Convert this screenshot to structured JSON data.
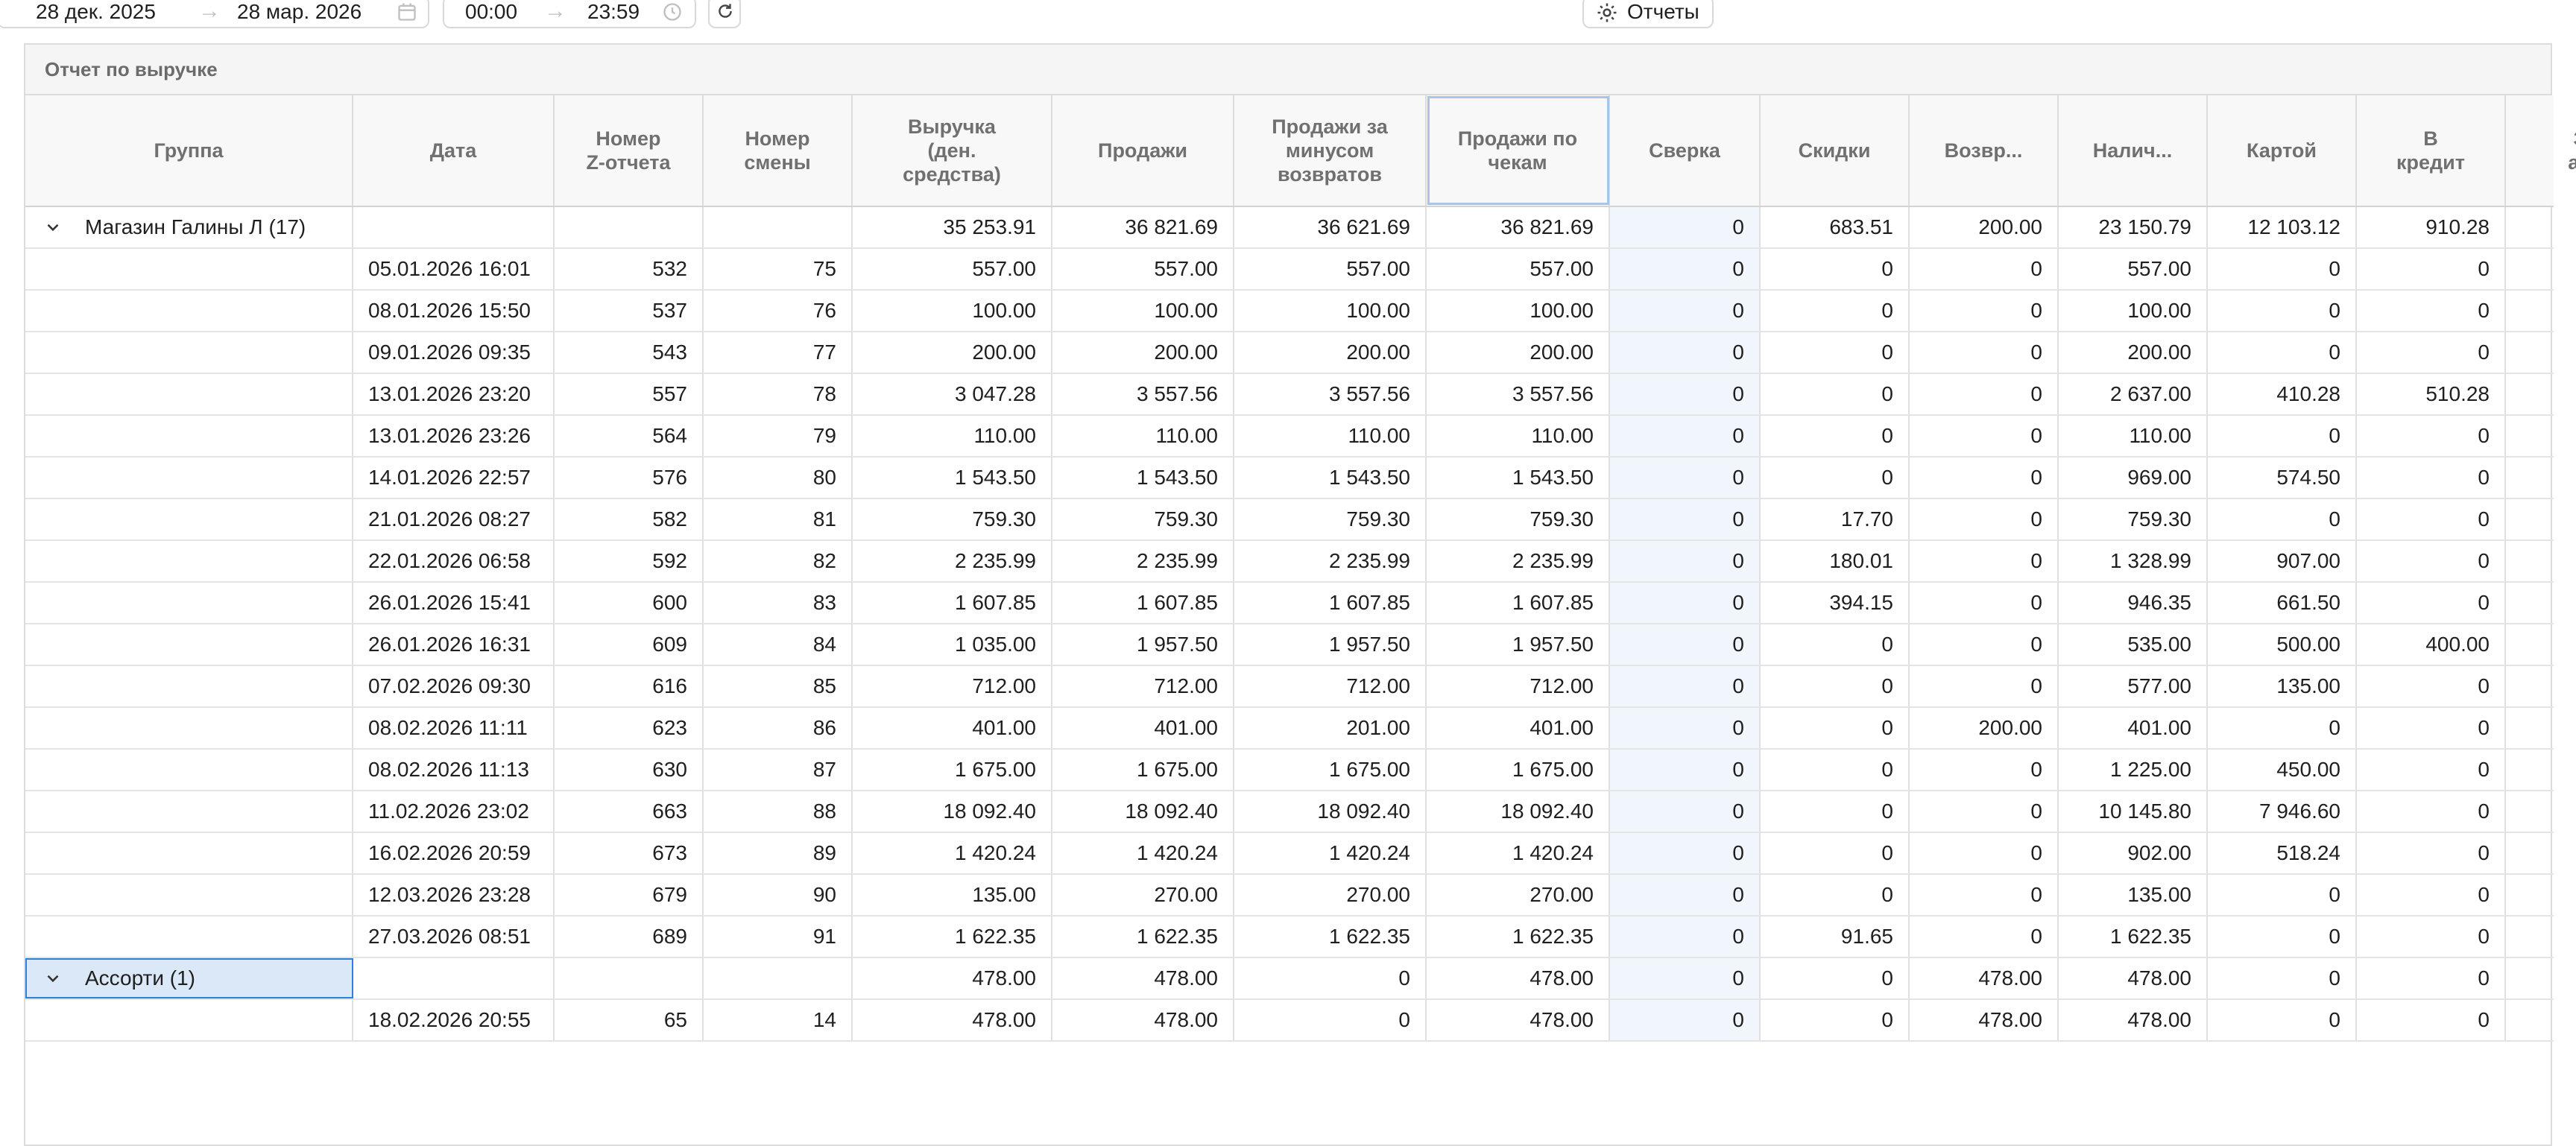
{
  "toolbar": {
    "date_from": "28 дек. 2025",
    "date_to": "28 мар. 2026",
    "time_from": "00:00",
    "time_to": "23:59",
    "arrow": "→",
    "reports_label": "Отчеты"
  },
  "report": {
    "title": "Отчет по выручке",
    "columns": [
      "Группа",
      "Дата",
      "Номер\nZ-отчета",
      "Номер\nсмены",
      "Выручка\n(ден.\nсредства)",
      "Продажи",
      "Продажи за\nминусом\nвозвратов",
      "Продажи по\nчекам",
      "Сверка",
      "Скидки",
      "Возвр...",
      "Налич...",
      "Картой",
      "В\nкредит",
      "З\nав"
    ],
    "groups": [
      {
        "name": "Магазин Галины Л (17)",
        "totals": [
          "",
          "",
          "",
          "35 253.91",
          "36 821.69",
          "36 621.69",
          "36 821.69",
          "0",
          "683.51",
          "200.00",
          "23 150.79",
          "12 103.12",
          "910.28",
          ""
        ],
        "rows": [
          [
            "05.01.2026 16:01",
            "532",
            "75",
            "557.00",
            "557.00",
            "557.00",
            "557.00",
            "0",
            "0",
            "0",
            "557.00",
            "0",
            "0",
            ""
          ],
          [
            "08.01.2026 15:50",
            "537",
            "76",
            "100.00",
            "100.00",
            "100.00",
            "100.00",
            "0",
            "0",
            "0",
            "100.00",
            "0",
            "0",
            ""
          ],
          [
            "09.01.2026 09:35",
            "543",
            "77",
            "200.00",
            "200.00",
            "200.00",
            "200.00",
            "0",
            "0",
            "0",
            "200.00",
            "0",
            "0",
            ""
          ],
          [
            "13.01.2026 23:20",
            "557",
            "78",
            "3 047.28",
            "3 557.56",
            "3 557.56",
            "3 557.56",
            "0",
            "0",
            "0",
            "2 637.00",
            "410.28",
            "510.28",
            ""
          ],
          [
            "13.01.2026 23:26",
            "564",
            "79",
            "110.00",
            "110.00",
            "110.00",
            "110.00",
            "0",
            "0",
            "0",
            "110.00",
            "0",
            "0",
            ""
          ],
          [
            "14.01.2026 22:57",
            "576",
            "80",
            "1 543.50",
            "1 543.50",
            "1 543.50",
            "1 543.50",
            "0",
            "0",
            "0",
            "969.00",
            "574.50",
            "0",
            ""
          ],
          [
            "21.01.2026 08:27",
            "582",
            "81",
            "759.30",
            "759.30",
            "759.30",
            "759.30",
            "0",
            "17.70",
            "0",
            "759.30",
            "0",
            "0",
            ""
          ],
          [
            "22.01.2026 06:58",
            "592",
            "82",
            "2 235.99",
            "2 235.99",
            "2 235.99",
            "2 235.99",
            "0",
            "180.01",
            "0",
            "1 328.99",
            "907.00",
            "0",
            ""
          ],
          [
            "26.01.2026 15:41",
            "600",
            "83",
            "1 607.85",
            "1 607.85",
            "1 607.85",
            "1 607.85",
            "0",
            "394.15",
            "0",
            "946.35",
            "661.50",
            "0",
            ""
          ],
          [
            "26.01.2026 16:31",
            "609",
            "84",
            "1 035.00",
            "1 957.50",
            "1 957.50",
            "1 957.50",
            "0",
            "0",
            "0",
            "535.00",
            "500.00",
            "400.00",
            ""
          ],
          [
            "07.02.2026 09:30",
            "616",
            "85",
            "712.00",
            "712.00",
            "712.00",
            "712.00",
            "0",
            "0",
            "0",
            "577.00",
            "135.00",
            "0",
            ""
          ],
          [
            "08.02.2026 11:11",
            "623",
            "86",
            "401.00",
            "401.00",
            "201.00",
            "401.00",
            "0",
            "0",
            "200.00",
            "401.00",
            "0",
            "0",
            ""
          ],
          [
            "08.02.2026 11:13",
            "630",
            "87",
            "1 675.00",
            "1 675.00",
            "1 675.00",
            "1 675.00",
            "0",
            "0",
            "0",
            "1 225.00",
            "450.00",
            "0",
            ""
          ],
          [
            "11.02.2026 23:02",
            "663",
            "88",
            "18 092.40",
            "18 092.40",
            "18 092.40",
            "18 092.40",
            "0",
            "0",
            "0",
            "10 145.80",
            "7 946.60",
            "0",
            ""
          ],
          [
            "16.02.2026 20:59",
            "673",
            "89",
            "1 420.24",
            "1 420.24",
            "1 420.24",
            "1 420.24",
            "0",
            "0",
            "0",
            "902.00",
            "518.24",
            "0",
            ""
          ],
          [
            "12.03.2026 23:28",
            "679",
            "90",
            "135.00",
            "270.00",
            "270.00",
            "270.00",
            "0",
            "0",
            "0",
            "135.00",
            "0",
            "0",
            ""
          ],
          [
            "27.03.2026 08:51",
            "689",
            "91",
            "1 622.35",
            "1 622.35",
            "1 622.35",
            "1 622.35",
            "0",
            "91.65",
            "0",
            "1 622.35",
            "0",
            "0",
            ""
          ]
        ]
      },
      {
        "name": "Ассорти (1)",
        "totals": [
          "",
          "",
          "",
          "478.00",
          "478.00",
          "0",
          "478.00",
          "0",
          "0",
          "478.00",
          "478.00",
          "0",
          "0",
          ""
        ],
        "rows": [
          [
            "18.02.2026 20:55",
            "65",
            "14",
            "478.00",
            "478.00",
            "0",
            "478.00",
            "0",
            "0",
            "478.00",
            "478.00",
            "0",
            "0",
            ""
          ]
        ]
      }
    ]
  }
}
